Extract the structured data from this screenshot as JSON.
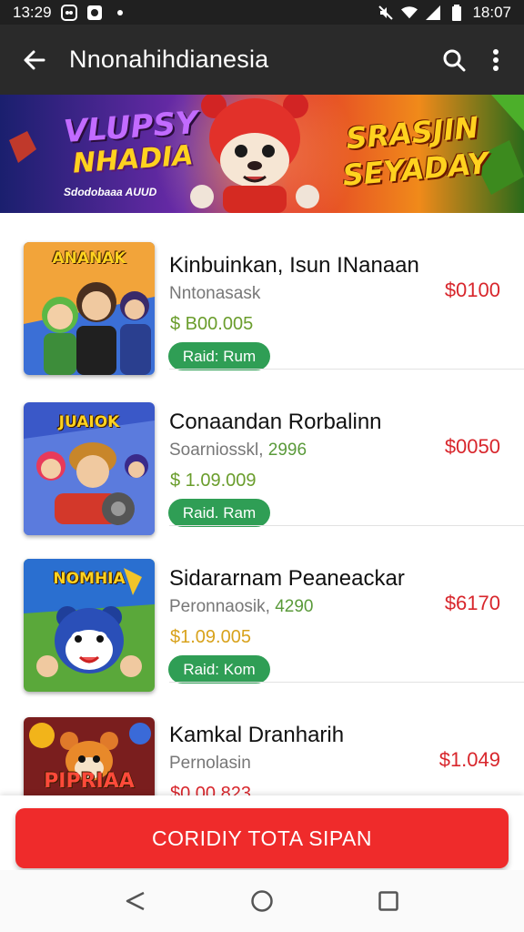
{
  "status_bar": {
    "time_left": "13:29",
    "time_right": "18:07"
  },
  "app_bar": {
    "title": "Nnonahihdianesia"
  },
  "banner": {
    "left_line1": "VLUPSY",
    "left_line2": "NHADIA",
    "left_sub": "Sdodobaaa AUUD",
    "right_line1": "SRASJIN",
    "right_line2": "SEYADAY"
  },
  "items": [
    {
      "thumb_label": "ANANAK",
      "title": "Kinbuinkan, Isun INanaan",
      "subtitle": "Nntonasask",
      "subtitle_extra": "",
      "price": "$ B00.005",
      "badge": "Raid: Rum",
      "right_price": "$0100"
    },
    {
      "thumb_label": "JUAIOK",
      "title": "Conaandan Rorbalinn",
      "subtitle": "Soarniosskl,",
      "subtitle_extra": "2996",
      "price": "$ 1.09.009",
      "badge": "Raid. Ram",
      "right_price": "$0050"
    },
    {
      "thumb_label": "NOMHIA",
      "title": "Sidararnam Peaneackar",
      "subtitle": "Peronnaosik,",
      "subtitle_extra": "4290",
      "price": "$1.09.005",
      "badge": "Raid: Kom",
      "right_price": "$6170"
    },
    {
      "thumb_label": "PIPRIAA",
      "title": "Kamkal Dranharih",
      "subtitle": "Pernolasin",
      "subtitle_extra": "",
      "price": "$0.00.823",
      "badge": "",
      "right_price": "$1.049"
    }
  ],
  "cta": {
    "label": "CORIDIY TOTA SIPAN"
  },
  "colors": {
    "accent_red": "#ef2b2b",
    "badge_green": "#2f9e55",
    "price_red": "#d8262c"
  }
}
